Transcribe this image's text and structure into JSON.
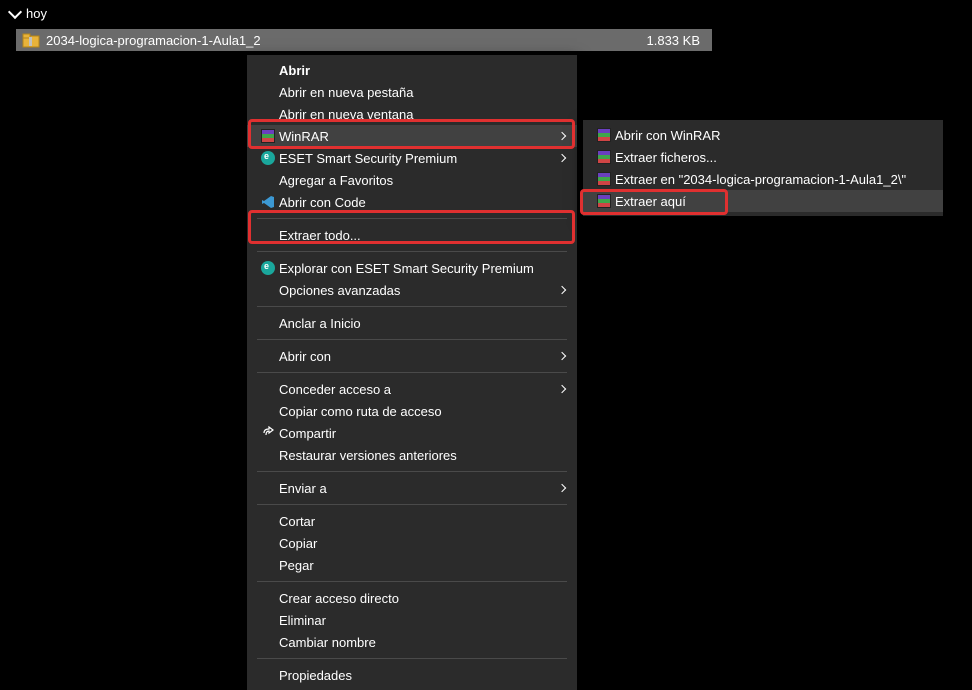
{
  "group": {
    "label": "hoy"
  },
  "file": {
    "name": "2034-logica-programacion-1-Aula1_2",
    "size": "1.833 KB"
  },
  "menu": {
    "abrir": "Abrir",
    "abrir_pestana": "Abrir en nueva pestaña",
    "abrir_ventana": "Abrir en nueva ventana",
    "winrar": "WinRAR",
    "eset_smart": "ESET Smart Security Premium",
    "agregar_fav": "Agregar a Favoritos",
    "abrir_code": "Abrir con Code",
    "extraer_todo": "Extraer todo...",
    "explorar_eset": "Explorar con ESET Smart Security Premium",
    "opc_avanzadas": "Opciones avanzadas",
    "anclar_inicio": "Anclar a Inicio",
    "abrir_con": "Abrir con",
    "conceder_acceso": "Conceder acceso a",
    "copiar_ruta": "Copiar como ruta de acceso",
    "compartir": "Compartir",
    "restaurar_ver": "Restaurar versiones anteriores",
    "enviar_a": "Enviar a",
    "cortar": "Cortar",
    "copiar": "Copiar",
    "pegar": "Pegar",
    "crear_acceso": "Crear acceso directo",
    "eliminar": "Eliminar",
    "cambiar_nombre": "Cambiar nombre",
    "propiedades": "Propiedades"
  },
  "submenu": {
    "abrir_winrar": "Abrir con WinRAR",
    "extraer_ficheros": "Extraer ficheros...",
    "extraer_en": "Extraer en \"2034-logica-programacion-1-Aula1_2\\\"",
    "extraer_aqui": "Extraer aquí"
  }
}
